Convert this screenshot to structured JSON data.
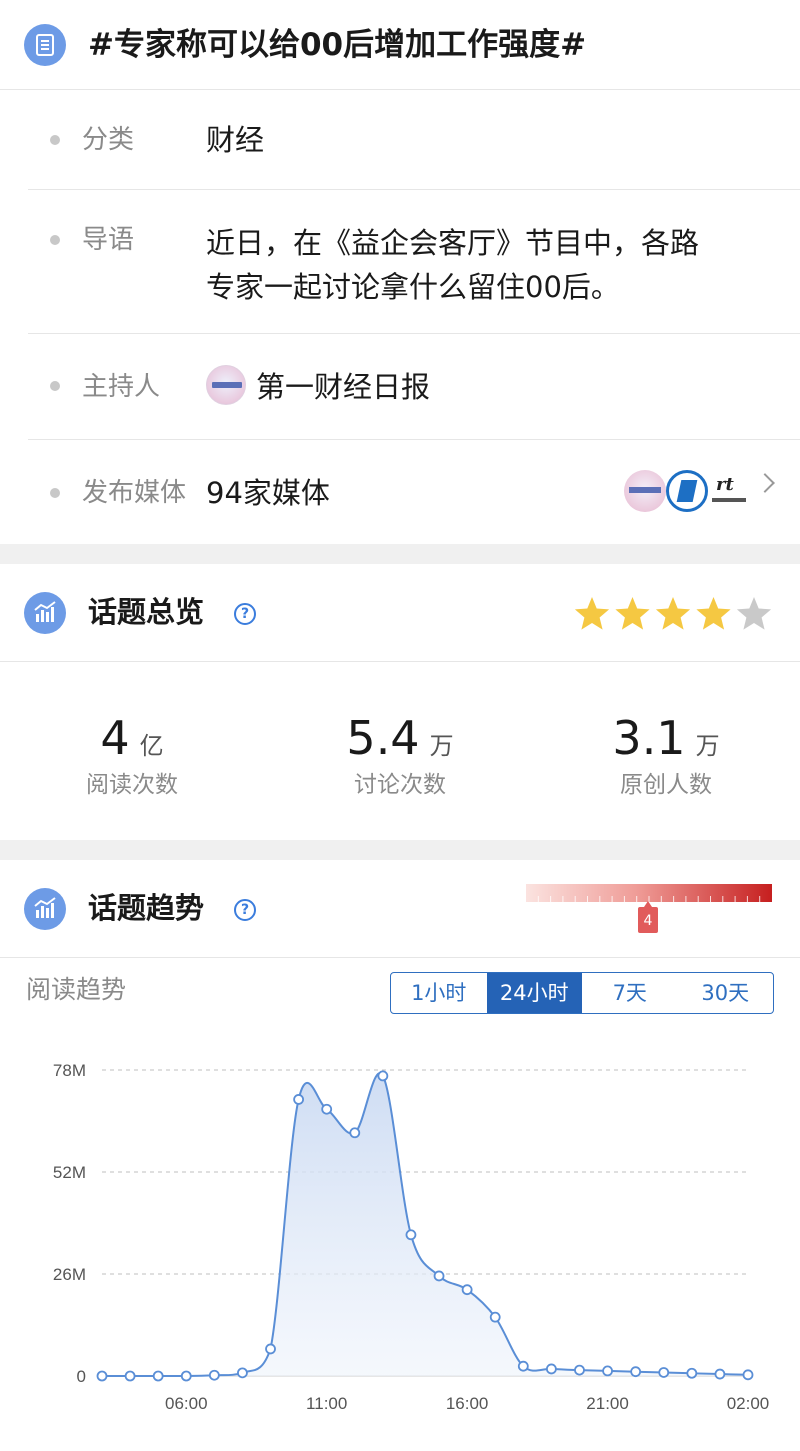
{
  "header": {
    "title": "#专家称可以给00后增加工作强度#",
    "icon": "list-icon"
  },
  "info": {
    "category": {
      "label": "分类",
      "value": "财经"
    },
    "intro": {
      "label": "导语",
      "line1": "近日，在《益企会客厅》节目中，各路",
      "line2": "专家一起讨论拿什么留住00后。"
    },
    "host": {
      "label": "主持人",
      "value": "第一财经日报"
    },
    "media": {
      "label": "发布媒体",
      "value": "94家媒体"
    }
  },
  "overview": {
    "title": "话题总览",
    "rating": 4,
    "rating_max": 5,
    "stats": [
      {
        "value": "4",
        "unit": "亿",
        "label": "阅读次数"
      },
      {
        "value": "5.4",
        "unit": "万",
        "label": "讨论次数"
      },
      {
        "value": "3.1",
        "unit": "万",
        "label": "原创人数"
      }
    ]
  },
  "trend": {
    "title": "话题趋势",
    "heat_value": "4",
    "reading_label": "阅读趋势",
    "ranges": [
      "1小时",
      "24小时",
      "7天",
      "30天"
    ],
    "active_range": "24小时"
  },
  "colors": {
    "accent": "#2563b6",
    "icon_bg": "#6d9be6",
    "star": "#f5c842",
    "line": "#5a8ed6"
  },
  "chart_data": {
    "type": "area",
    "xlabel": "",
    "ylabel": "",
    "y_ticks": [
      "0",
      "26M",
      "52M",
      "78M"
    ],
    "x_ticks": [
      "06:00",
      "11:00",
      "16:00",
      "21:00",
      "02:00"
    ],
    "ylim": [
      0,
      78
    ],
    "x": [
      3,
      4,
      5,
      6,
      7,
      8,
      9,
      10,
      11,
      12,
      13,
      14,
      15,
      16,
      17,
      18,
      19,
      20,
      21,
      22,
      23,
      24,
      25,
      26
    ],
    "series": [
      {
        "values": [
          0,
          0,
          0,
          0,
          0.2,
          0.8,
          6.9,
          70.5,
          68,
          62,
          76.5,
          36,
          25.5,
          22,
          15,
          2.5,
          1.8,
          1.5,
          1.3,
          1.1,
          0.9,
          0.7,
          0.5,
          0.3
        ]
      }
    ]
  }
}
